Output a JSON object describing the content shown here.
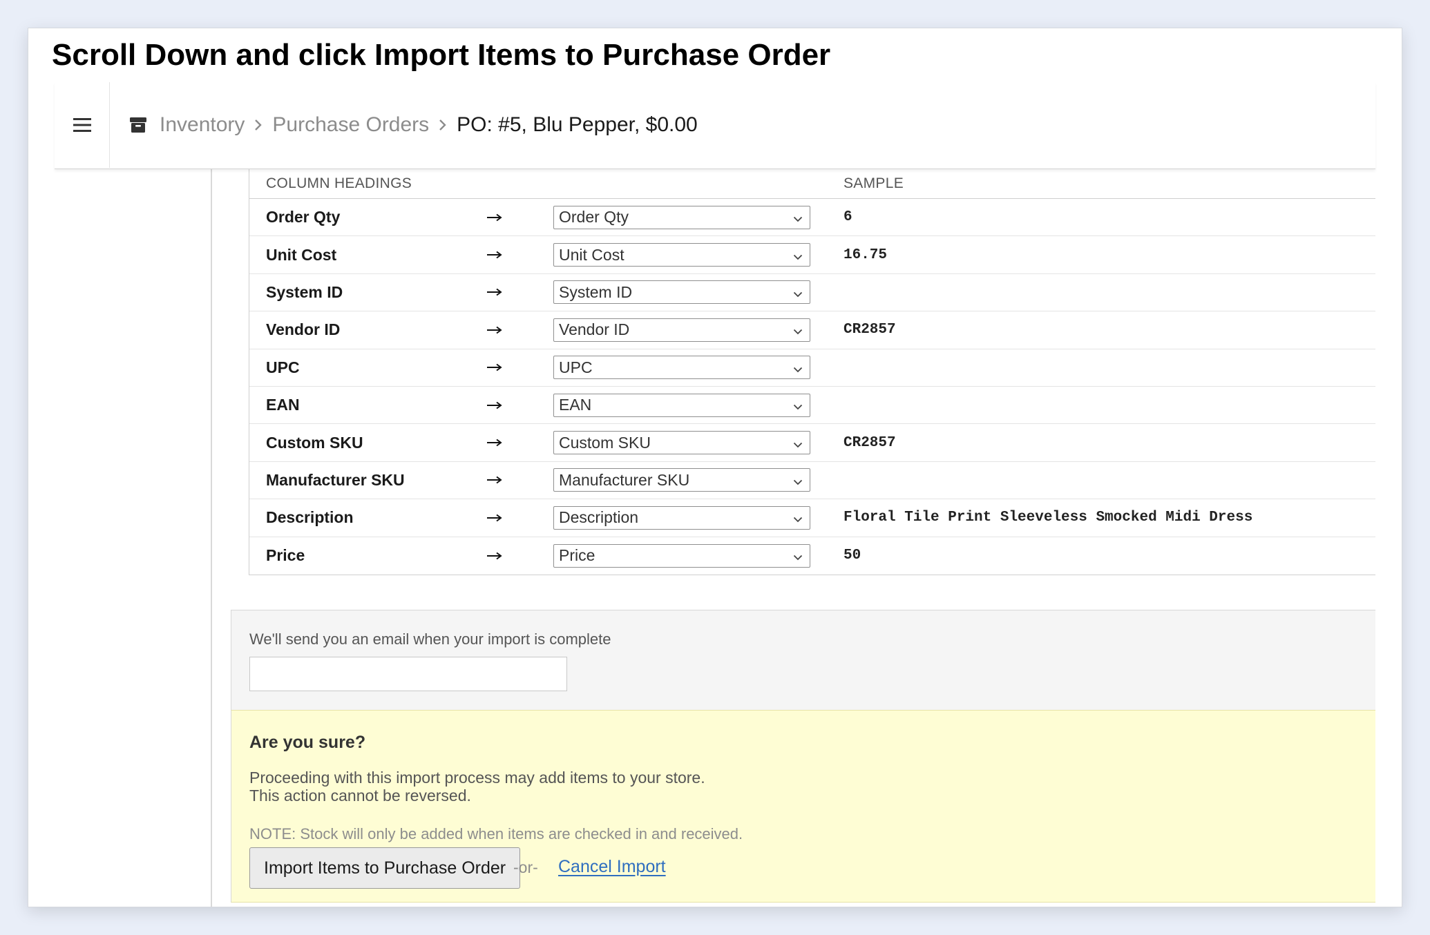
{
  "instruction": "Scroll Down and click Import Items to Purchase Order",
  "breadcrumb": {
    "items": [
      "Inventory",
      "Purchase Orders"
    ],
    "current": "PO: #5, Blu Pepper, $0.00"
  },
  "icons": {
    "menu": "hamburger-menu-icon",
    "section": "archive-box-icon",
    "separator": "chevron-right-icon",
    "arrow": "right-arrow-icon",
    "dropdown": "chevron-down-icon"
  },
  "table": {
    "headers": {
      "name": "COLUMN HEADINGS",
      "sample": "SAMPLE"
    },
    "rows": [
      {
        "name": "Order Qty",
        "arrow": "→",
        "mapping": "Order Qty",
        "sample": "6"
      },
      {
        "name": "Unit Cost",
        "arrow": "→",
        "mapping": "Unit Cost",
        "sample": "16.75"
      },
      {
        "name": "System ID",
        "arrow": "→",
        "mapping": "System ID",
        "sample": ""
      },
      {
        "name": "Vendor ID",
        "arrow": "→",
        "mapping": "Vendor ID",
        "sample": "CR2857"
      },
      {
        "name": "UPC",
        "arrow": "→",
        "mapping": "UPC",
        "sample": ""
      },
      {
        "name": "EAN",
        "arrow": "→",
        "mapping": "EAN",
        "sample": ""
      },
      {
        "name": "Custom SKU",
        "arrow": "→",
        "mapping": "Custom SKU",
        "sample": "CR2857"
      },
      {
        "name": "Manufacturer SKU",
        "arrow": "→",
        "mapping": "Manufacturer SKU",
        "sample": ""
      },
      {
        "name": "Description",
        "arrow": "→",
        "mapping": "Description",
        "sample": "Floral Tile Print Sleeveless Smocked Midi Dress"
      },
      {
        "name": "Price",
        "arrow": "→",
        "mapping": "Price",
        "sample": "50"
      }
    ]
  },
  "email": {
    "label": "We'll send you an email when your import is complete",
    "value": ""
  },
  "confirm": {
    "title": "Are you sure?",
    "line1": "Proceeding with this import process may add items to your store.",
    "line2": "This action cannot be reversed.",
    "note": "NOTE: Stock will only be added when items are checked in and received.",
    "import_button": "Import Items to Purchase Order",
    "or_text": "-or-",
    "cancel_link": "Cancel Import"
  },
  "colors": {
    "page_background": "#e9eef8",
    "confirm_background": "#fefdd4",
    "link": "#2f6ebf"
  }
}
